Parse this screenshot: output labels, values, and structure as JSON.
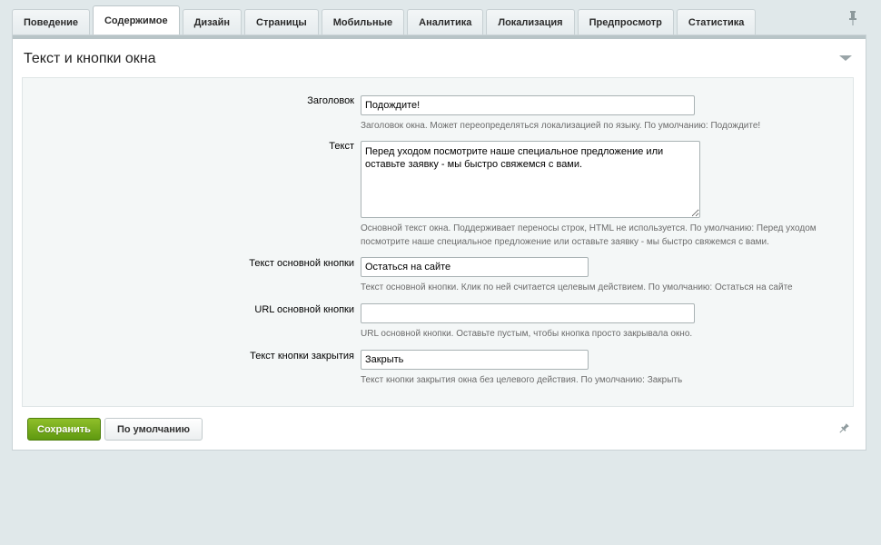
{
  "tabs": [
    {
      "label": "Поведение"
    },
    {
      "label": "Содержимое"
    },
    {
      "label": "Дизайн"
    },
    {
      "label": "Страницы"
    },
    {
      "label": "Мобильные"
    },
    {
      "label": "Аналитика"
    },
    {
      "label": "Локализация"
    },
    {
      "label": "Предпросмотр"
    },
    {
      "label": "Статистика"
    }
  ],
  "active_tab": "Содержимое",
  "section": {
    "title": "Текст и кнопки окна"
  },
  "form": {
    "title_field": {
      "label": "Заголовок",
      "value": "Подождите!",
      "hint": "Заголовок окна. Может переопределяться локализацией по языку. По умолчанию: Подождите!"
    },
    "text_field": {
      "label": "Текст",
      "value": "Перед уходом посмотрите наше специальное предложение или оставьте заявку - мы быстро свяжемся с вами.",
      "hint": "Основной текст окна. Поддерживает переносы строк, HTML не используется. По умолчанию: Перед уходом посмотрите наше специальное предложение или оставьте заявку - мы быстро свяжемся с вами."
    },
    "primary_button_text": {
      "label": "Текст основной кнопки",
      "value": "Остаться на сайте",
      "hint": "Текст основной кнопки. Клик по ней считается целевым действием. По умолчанию: Остаться на сайте"
    },
    "primary_button_url": {
      "label": "URL основной кнопки",
      "value": "",
      "hint": "URL основной кнопки. Оставьте пустым, чтобы кнопка просто закрывала окно."
    },
    "close_button_text": {
      "label": "Текст кнопки закрытия",
      "value": "Закрыть",
      "hint": "Текст кнопки закрытия окна без целевого действия. По умолчанию: Закрыть"
    }
  },
  "buttons": {
    "save": "Сохранить",
    "default": "По умолчанию"
  },
  "colors": {
    "save_button": "#6ea51a",
    "page_background": "#e0e8ea"
  },
  "icons": {
    "pin_top": "pin-icon",
    "collapse": "triangle-down-icon",
    "pin_bottom": "pin-icon"
  }
}
